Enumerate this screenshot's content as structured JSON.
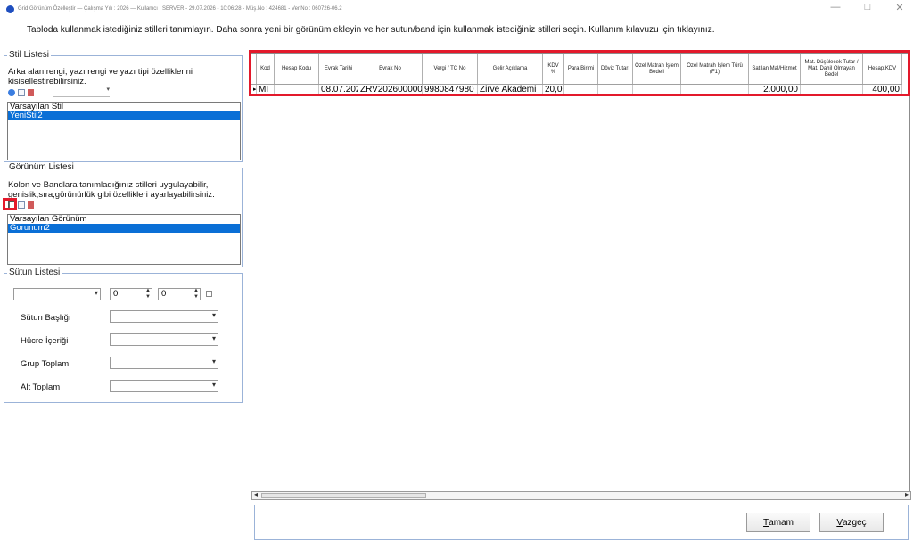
{
  "window": {
    "title": "Grid Görünüm Özelleştir  —  Çalışma Yılı : 2026  —  Kullanıcı : SERVER - 29.07.2026 - 10:06:28 - Müş.No : 424681 - Ver.No : 060726-06.2",
    "minimize": "—",
    "maximize": "□",
    "close": "✕"
  },
  "instruction": "Tabloda kullanmak istediğiniz stilleri tanımlayın. Daha sonra  yeni bir görünüm ekleyin ve her sutun/band için kullanmak istediğiniz stilleri seçin. Kullanım kılavuzu için tıklayınız.",
  "style_panel": {
    "title": "Stil Listesi",
    "description": "Arka alan rengi, yazı rengi ve yazı tipi özelliklerini kisisellestirebilirsiniz.",
    "items": [
      "Varsayılan Stil",
      "YeniStil2"
    ],
    "selected_index": 1
  },
  "view_panel": {
    "title": "Görünüm Listesi",
    "description": "Kolon ve Bandlara tanımladığınız stilleri uygulayabilir, genislik,sıra,görünürlük gibi özellikleri ayarlayabilirsiniz.",
    "items": [
      "Varsayılan Görünüm",
      "Gorunum2"
    ],
    "selected_index": 1
  },
  "column_panel": {
    "title": "Sütun Listesi",
    "spin1": "0",
    "spin2": "0",
    "labels": {
      "header": "Sütun Başlığı",
      "cell": "Hücre İçeriği",
      "group_total": "Grup Toplamı",
      "sub_total": "Alt Toplam"
    }
  },
  "grid": {
    "columns": [
      "Kod",
      "Hesap Kodu",
      "Evrak Tarihi",
      "Evrak No",
      "Vergi / TC No",
      "Gelir Açıklama",
      "KDV %",
      "Para Birimi",
      "Döviz Tutarı",
      "Özel Matrah İşlem Bedeli",
      "Özel Matrah İşlem Türü (F1)",
      "Satılan Mal/Hizmet",
      "Mat. Düşülecek Tutar / Mat. Dahil Olmayan Bedel",
      "Hesap.KDV"
    ],
    "row": [
      "MI",
      "",
      "08.07.202",
      "ZRV2026000000",
      "9980847980",
      "Zirve Akademi",
      "20,00",
      "",
      "",
      "",
      "",
      "2.000,00",
      "",
      "400,00"
    ]
  },
  "buttons": {
    "ok_u": "T",
    "ok_rest": "amam",
    "cancel_u": "V",
    "cancel_rest": "azgeç"
  },
  "colors": {
    "highlight": "#e3192b",
    "selection": "#0a6fd6",
    "panel_border": "#9bb3d8"
  }
}
